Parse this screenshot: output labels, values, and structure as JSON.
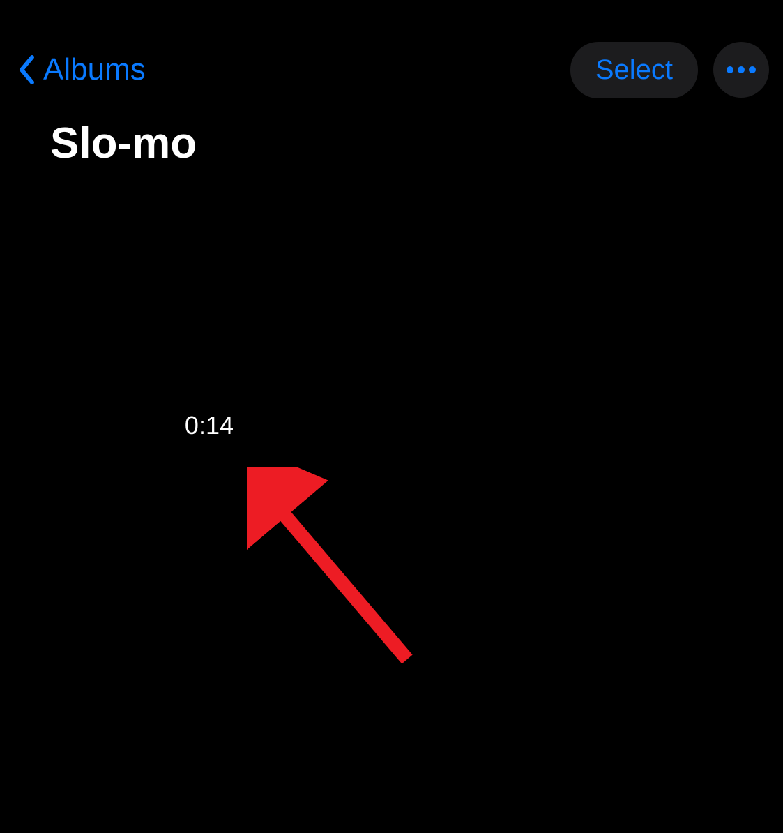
{
  "nav": {
    "back_label": "Albums",
    "select_label": "Select"
  },
  "page": {
    "title": "Slo-mo"
  },
  "grid": {
    "items": [
      {
        "duration": "0:14"
      }
    ]
  },
  "colors": {
    "accent": "#0a7aff",
    "annotation": "#ed1c24"
  }
}
